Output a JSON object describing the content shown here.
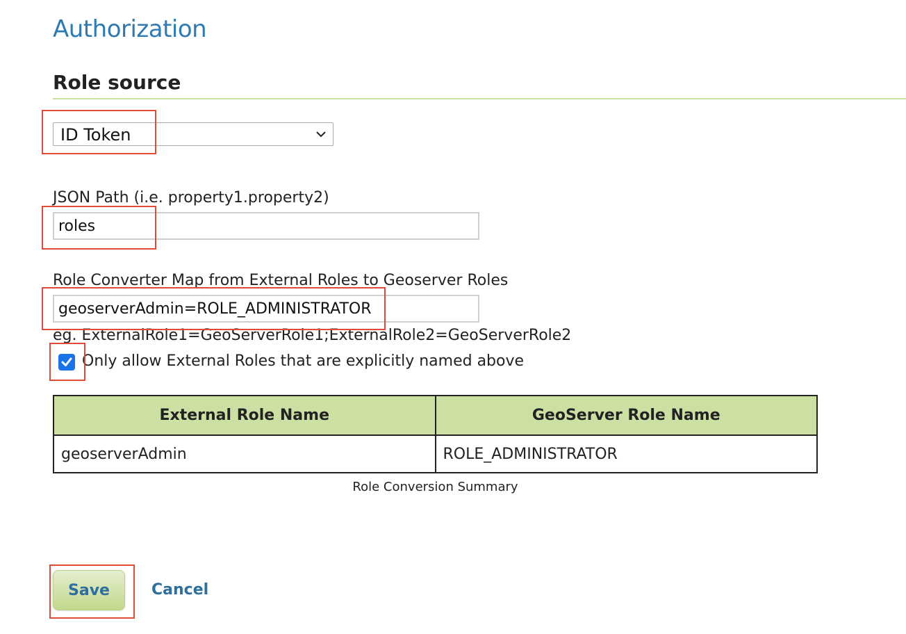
{
  "page": {
    "title": "Authorization"
  },
  "role_source": {
    "heading": "Role source",
    "selected": "ID Token"
  },
  "json_path": {
    "label": "JSON Path (i.e. property1.property2)",
    "value": "roles"
  },
  "role_converter": {
    "label": "Role Converter Map from External Roles to Geoserver Roles",
    "value": "geoserverAdmin=ROLE_ADMINISTRATOR",
    "hint": "eg. ExternalRole1=GeoServerRole1;ExternalRole2=GeoServerRole2"
  },
  "only_allow": {
    "checked": true,
    "label": "Only allow External Roles that are explicitly named above"
  },
  "role_table": {
    "headers": [
      "External Role Name",
      "GeoServer Role Name"
    ],
    "rows": [
      [
        "geoserverAdmin",
        "ROLE_ADMINISTRATOR"
      ]
    ],
    "caption": "Role Conversion Summary"
  },
  "actions": {
    "save_label": "Save",
    "cancel_label": "Cancel"
  },
  "colors": {
    "title": "#2e7ab1",
    "header_row": "#cde0a4",
    "highlight": "#de4b39",
    "checkbox": "#1a73e8",
    "link": "#2e6f9e"
  },
  "icons": {
    "select_arrow": "chevron-down-icon",
    "checkbox_mark": "checkmark-icon"
  }
}
